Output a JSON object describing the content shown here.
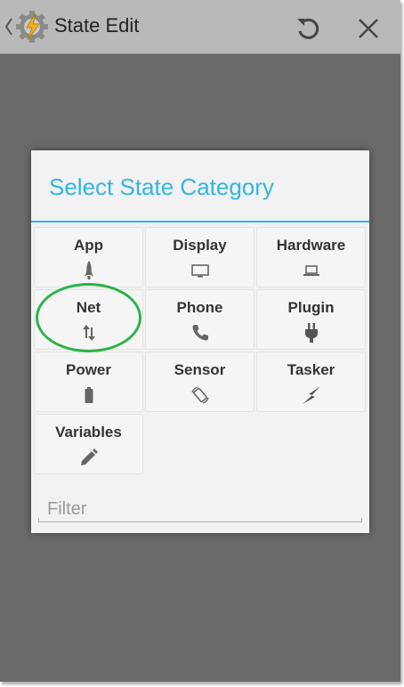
{
  "actionbar": {
    "title": "State Edit",
    "logo_icon": "tasker-bolt-gear-icon",
    "revert_icon": "revert-icon",
    "close_icon": "close-icon"
  },
  "dialog": {
    "title": "Select State Category",
    "accent_color": "#33b5e5",
    "categories": [
      {
        "label": "App",
        "icon": "rocket-icon"
      },
      {
        "label": "Display",
        "icon": "monitor-icon"
      },
      {
        "label": "Hardware",
        "icon": "laptop-icon"
      },
      {
        "label": "Net",
        "icon": "updown-arrows-icon"
      },
      {
        "label": "Phone",
        "icon": "phone-icon"
      },
      {
        "label": "Plugin",
        "icon": "plug-icon"
      },
      {
        "label": "Power",
        "icon": "battery-icon"
      },
      {
        "label": "Sensor",
        "icon": "screen-rotation-icon"
      },
      {
        "label": "Tasker",
        "icon": "lightning-icon"
      },
      {
        "label": "Variables",
        "icon": "pencil-icon"
      }
    ],
    "filter": {
      "placeholder": "Filter"
    }
  },
  "annotation": {
    "color": "#2db34a",
    "target": "Net"
  }
}
